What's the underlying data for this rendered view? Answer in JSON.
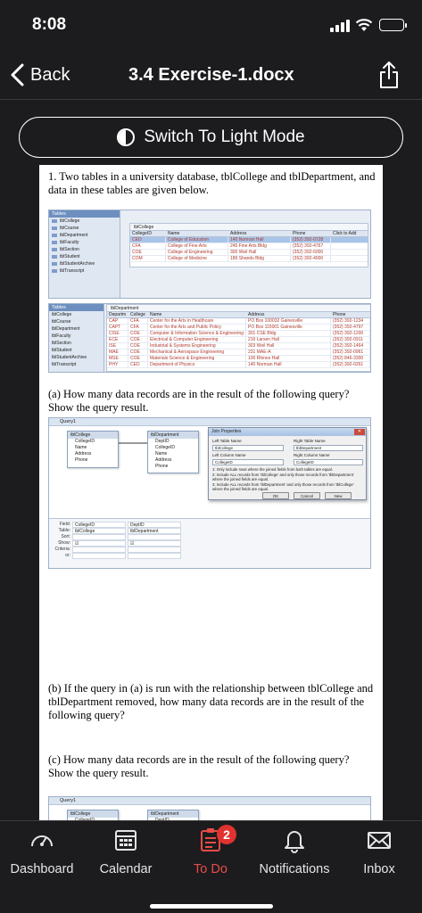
{
  "status": {
    "time": "8:08"
  },
  "nav": {
    "back_label": "Back",
    "title": "3.4 Exercise-1.docx"
  },
  "toggle": {
    "label": "Switch To Light Mode"
  },
  "doc": {
    "question1": "1. Two tables in a university database, tblCollege and tblDepartment, and data in these tables are given below.",
    "qa": "(a) How many data records are in the result of the following query? Show the query result.",
    "qb": "(b) If the query in (a) is run with the relationship between tblCollege and tblDepartment removed, how many data records are in the result of the following query?",
    "qc": "(c) How many data records are in the result of the following query? Show the query result."
  },
  "access1": {
    "nav_header": "Tables",
    "nav_items": [
      "tblCollege",
      "tblCourse",
      "tblDepartment",
      "tblFaculty",
      "tblSection",
      "tblStudent",
      "tblStudentArchive",
      "tblTranscript"
    ],
    "tab": "tblCollege",
    "columns": [
      "CollegeID",
      "Name",
      "Address",
      "Phone",
      "Click to Add"
    ],
    "rows": [
      [
        "CED",
        "College of Education",
        "140 Norman Hall",
        "(352) 392-0728",
        ""
      ],
      [
        "CFA",
        "College of Fine Arts",
        "245 Fine Arts Bldg",
        "(352) 392-4767",
        ""
      ],
      [
        "COE",
        "College of Engineering",
        "300 Weil Hall",
        "(352) 392-6000",
        ""
      ],
      [
        "COM",
        "College of Medicine",
        "189 Shands Bldg",
        "(352) 392-4000",
        ""
      ]
    ]
  },
  "access2": {
    "tab": "tblDepartment",
    "columns": [
      "Departm",
      "College",
      "Name",
      "Address",
      "Phone"
    ],
    "rows": [
      [
        "CAP",
        "CFA",
        "Center for the Arts in Healthcare",
        "PO Box 100032 Gainesville",
        "(352) 392-1234"
      ],
      [
        "CAPT",
        "CFA",
        "Center for the Arts and Public Policy",
        "PO Box 115001 Gainesville",
        "(352) 392-4797"
      ],
      [
        "CISE",
        "COE",
        "Computer & Information Science & Engineering",
        "301 CSE Bldg",
        "(352) 392-1200"
      ],
      [
        "ECE",
        "COE",
        "Electrical & Computer Engineering",
        "216 Larsen Hall",
        "(352) 392-0911"
      ],
      [
        "ISE",
        "COE",
        "Industrial & Systems Engineering",
        "303 Weil Hall",
        "(352) 392-1464"
      ],
      [
        "MAE",
        "COE",
        "Mechanical & Aerospace Engineering",
        "231 MAE-A",
        "(352) 392-0961"
      ],
      [
        "MSE",
        "COE",
        "Materials Science & Engineering",
        "100 Rhines Hall",
        "(352) 846-3300"
      ],
      [
        "PHY",
        "CED",
        "Department of Physics",
        "140 Norman Hall",
        "(352) 392-0261"
      ]
    ]
  },
  "query1": {
    "title": "Query1",
    "left_table": "tblCollege",
    "left_fields": [
      "CollegeID",
      "Name",
      "Address",
      "Phone"
    ],
    "right_table": "tblDepartment",
    "right_fields": [
      "DeptID",
      "CollegeID",
      "Name",
      "Address",
      "Phone"
    ],
    "grid_labels": [
      "Field:",
      "Table:",
      "Sort:",
      "Show:",
      "Criteria:",
      "or:"
    ],
    "grid_fields": [
      "CollegeID",
      "DeptID"
    ],
    "grid_tables": [
      "tblCollege",
      "tblDepartment"
    ],
    "join": {
      "title": "Join Properties",
      "left_table_label": "Left Table Name",
      "right_table_label": "Right Table Name",
      "left_table": "tblCollege",
      "right_table": "tblDepartment",
      "left_col_label": "Left Column Name",
      "right_col_label": "Right Column Name",
      "left_col": "CollegeID",
      "right_col": "CollegeID",
      "opt1": "1: Only include rows where the joined fields from both tables are equal.",
      "opt2": "2: Include ALL records from 'tblCollege' and only those records from 'tblDepartment' where the joined fields are equal.",
      "opt3": "3: Include ALL records from 'tblDepartment' and only those records from 'tblCollege' where the joined fields are equal.",
      "ok": "OK",
      "cancel": "Cancel",
      "new": "New"
    }
  },
  "tabs": [
    {
      "label": "Dashboard"
    },
    {
      "label": "Calendar"
    },
    {
      "label": "To Do",
      "badge": "2"
    },
    {
      "label": "Notifications"
    },
    {
      "label": "Inbox"
    }
  ],
  "colors": {
    "accent": "#e94c48",
    "background": "#1c1c1e"
  }
}
